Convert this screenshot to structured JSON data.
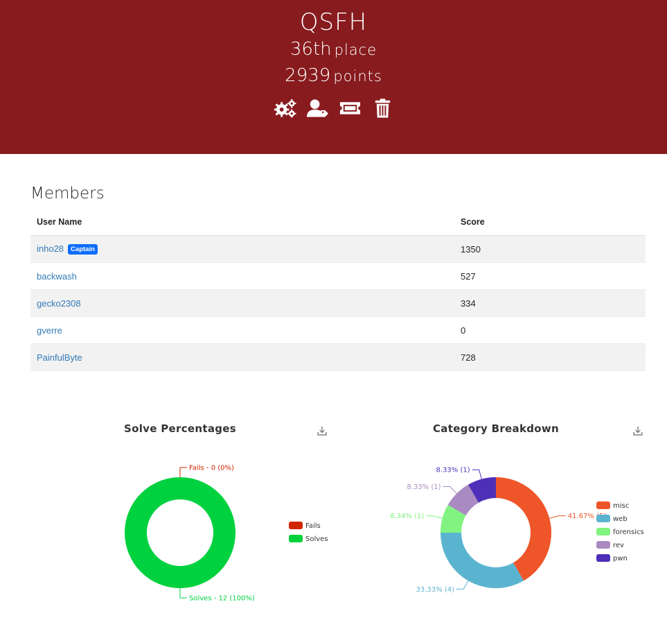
{
  "team": {
    "name": "QSFH",
    "place_number": "36th",
    "place_word": "place",
    "points_number": "2939",
    "points_word": "points"
  },
  "actions": [
    {
      "icon": "gears-icon",
      "label": "settings"
    },
    {
      "icon": "user-tag-icon",
      "label": "captain"
    },
    {
      "icon": "ticket-icon",
      "label": "invite"
    },
    {
      "icon": "trash-icon",
      "label": "disband"
    }
  ],
  "members": {
    "title": "Members",
    "headers": {
      "user": "User Name",
      "score": "Score"
    },
    "rows": [
      {
        "name": "inho28",
        "badge": "Captain",
        "score": "1350"
      },
      {
        "name": "backwash",
        "badge": "",
        "score": "527"
      },
      {
        "name": "gecko2308",
        "badge": "",
        "score": "334"
      },
      {
        "name": "gverre",
        "badge": "",
        "score": "0"
      },
      {
        "name": "PainfulByte",
        "badge": "",
        "score": "728"
      }
    ]
  },
  "colors": {
    "header_bg": "#871b1e",
    "link": "#337ab7",
    "badge": "#0d6efd"
  },
  "chart_data": [
    {
      "type": "pie",
      "title": "Solve Percentages",
      "categories": [
        "Fails",
        "Solves"
      ],
      "values": [
        0,
        12
      ],
      "labels": [
        "Fails - 0 (0%)",
        "Solves - 12 (100%)"
      ],
      "colors": [
        "#cf2600",
        "#00d13f"
      ],
      "legend": "right"
    },
    {
      "type": "pie",
      "title": "Category Breakdown",
      "categories": [
        "misc",
        "web",
        "forensics",
        "rev",
        "pwn"
      ],
      "values": [
        5,
        4,
        1,
        1,
        1
      ],
      "labels": [
        "41.67% (5)",
        "33.33% (4)",
        "8.34% (1)",
        "8.33% (1)",
        "8.33% (1)"
      ],
      "colors": [
        "#ee5529",
        "#5bb4cf",
        "#80f380",
        "#a98bc2",
        "#4d2fb8"
      ],
      "legend": "right"
    }
  ]
}
